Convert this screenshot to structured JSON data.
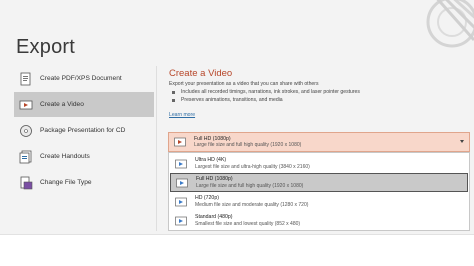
{
  "header": {
    "title": "Export"
  },
  "sidebar": {
    "items": [
      {
        "label": "Create PDF/XPS Document",
        "icon": "pdf-document-icon",
        "active": false
      },
      {
        "label": "Create a Video",
        "icon": "video-icon",
        "active": true
      },
      {
        "label": "Package Presentation for CD",
        "icon": "cd-icon",
        "active": false
      },
      {
        "label": "Create Handouts",
        "icon": "handouts-icon",
        "active": false
      },
      {
        "label": "Change File Type",
        "icon": "file-type-icon",
        "active": false
      }
    ]
  },
  "main": {
    "title": "Create a Video",
    "description": "Export your presentation as a video that you can share with others",
    "bullets": [
      "Includes all recorded timings, narrations, ink strokes, and laser pointer gestures",
      "Preserves animations, transitions, and media"
    ],
    "learn_more": "Learn more",
    "dropdown": {
      "selected_title": "Full HD (1080p)",
      "selected_sub": "Large file size and full high quality (1920 x 1080)",
      "options": [
        {
          "title": "Ultra HD (4K)",
          "sub": "Largest file size and ultra-high quality (3840 x 2160)"
        },
        {
          "title": "Full HD (1080p)",
          "sub": "Large file size and full high quality (1920 x 1080)",
          "selected": true
        },
        {
          "title": "HD (720p)",
          "sub": "Medium file size and moderate quality (1280 x 720)"
        },
        {
          "title": "Standard (480p)",
          "sub": "Smallest file size and lowest quality (852 x 480)"
        }
      ]
    }
  },
  "colors": {
    "accent": "#b7472a",
    "dropdown_bg": "#f8d7ca",
    "link": "#2e6da4",
    "active_nav": "#c9c9c9"
  }
}
